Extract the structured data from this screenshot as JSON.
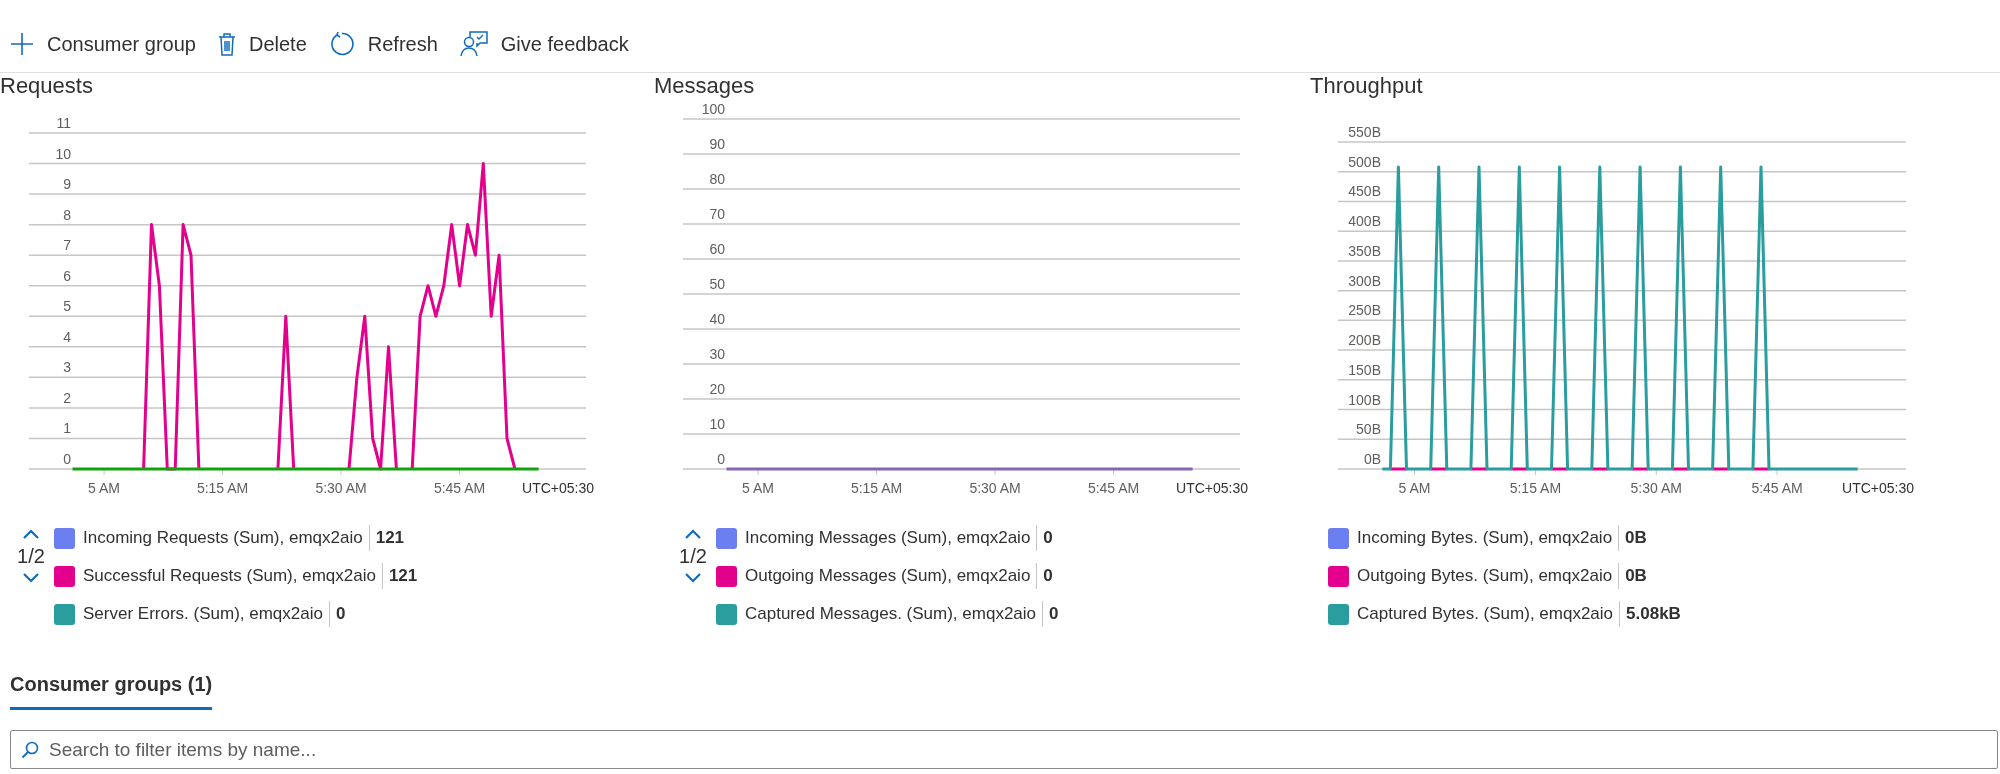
{
  "toolbar": [
    {
      "label": "Consumer group"
    },
    {
      "label": "Delete"
    },
    {
      "label": "Refresh"
    },
    {
      "label": "Give feedback"
    }
  ],
  "charts": [
    {
      "title": "Requests",
      "timezone": "UTC+05:30",
      "pager": "1/2",
      "chart_data": {
        "type": "line",
        "categories": [
          null,
          null,
          null,
          null,
          "5 AM",
          null,
          null,
          null,
          null,
          null,
          null,
          null,
          null,
          null,
          null,
          null,
          null,
          null,
          null,
          "5:15 AM",
          null,
          null,
          null,
          null,
          null,
          null,
          null,
          null,
          null,
          null,
          null,
          null,
          null,
          null,
          "5:30 AM",
          null,
          null,
          null,
          null,
          null,
          null,
          null,
          null,
          null,
          null,
          null,
          null,
          null,
          null,
          "5:45 AM",
          null,
          null,
          null,
          null,
          null,
          null,
          null,
          null,
          null,
          null
        ],
        "ylim": [
          0,
          11
        ],
        "yticks": [
          0,
          1,
          2,
          3,
          4,
          5,
          6,
          7,
          8,
          9,
          10,
          11
        ],
        "grid": true,
        "series": [
          {
            "name": "Incoming Requests (Sum), emqx2aio",
            "values": [
              null,
              null,
              null,
              null,
              null,
              null,
              null,
              null,
              null,
              null,
              null,
              null,
              null,
              null,
              null,
              null,
              null,
              null,
              null,
              null,
              null,
              null,
              null,
              null,
              null,
              null,
              null,
              null,
              null,
              null,
              null,
              null,
              null,
              null,
              null,
              null,
              null,
              null,
              null,
              null,
              null,
              null,
              null,
              null,
              null,
              null,
              null,
              null,
              null,
              null,
              null,
              null,
              null,
              null,
              null,
              null,
              null,
              null,
              null,
              null
            ]
          },
          {
            "name": "Successful Requests (Sum), emqx2aio",
            "color": "#e3008c",
            "values": [
              null,
              null,
              null,
              null,
              null,
              null,
              null,
              null,
              null,
              0,
              8,
              6,
              0,
              0,
              8,
              7,
              0,
              null,
              null,
              null,
              null,
              null,
              null,
              null,
              null,
              null,
              0,
              5,
              0,
              null,
              null,
              null,
              null,
              null,
              null,
              0,
              3,
              5,
              1,
              0,
              4,
              0,
              null,
              0,
              5,
              6,
              5,
              6,
              8,
              6,
              8,
              7,
              10,
              5,
              7,
              1,
              0,
              null,
              null,
              null
            ]
          },
          {
            "name": "Server Errors. (Sum), emqx2aio",
            "color": "#13a10e",
            "values": [
              0,
              0,
              0,
              0,
              0,
              0,
              0,
              0,
              0,
              0,
              0,
              0,
              0,
              0,
              0,
              0,
              0,
              0,
              0,
              0,
              0,
              0,
              0,
              0,
              0,
              0,
              0,
              0,
              0,
              0,
              0,
              0,
              0,
              0,
              0,
              0,
              0,
              0,
              0,
              0,
              0,
              0,
              0,
              0,
              0,
              0,
              0,
              0,
              0,
              0,
              0,
              0,
              0,
              0,
              0,
              0,
              0,
              0,
              0,
              0
            ]
          }
        ]
      },
      "legend": [
        {
          "color": "#6b7ff0",
          "value": "121"
        },
        {
          "color": "#e3008c",
          "value": "121"
        },
        {
          "color": "#2a9d9f",
          "value": "0"
        }
      ]
    },
    {
      "title": "Messages",
      "timezone": "UTC+05:30",
      "pager": "1/2",
      "chart_data": {
        "type": "line",
        "categories": [
          null,
          null,
          null,
          null,
          "5 AM",
          null,
          null,
          null,
          null,
          null,
          null,
          null,
          null,
          null,
          null,
          null,
          null,
          null,
          null,
          "5:15 AM",
          null,
          null,
          null,
          null,
          null,
          null,
          null,
          null,
          null,
          null,
          null,
          null,
          null,
          null,
          "5:30 AM",
          null,
          null,
          null,
          null,
          null,
          null,
          null,
          null,
          null,
          null,
          null,
          null,
          null,
          null,
          "5:45 AM",
          null,
          null,
          null,
          null,
          null,
          null,
          null,
          null,
          null,
          null
        ],
        "ylim": [
          0,
          100
        ],
        "yticks": [
          0,
          10,
          20,
          30,
          40,
          50,
          60,
          70,
          80,
          90,
          100
        ],
        "grid": true,
        "series": [
          {
            "name": "Incoming Messages (Sum), emqx2aio",
            "values": [
              null,
              null,
              null,
              null,
              null,
              null,
              null,
              null,
              null,
              null,
              null,
              null,
              null,
              null,
              null,
              null,
              null,
              null,
              null,
              null,
              null,
              null,
              null,
              null,
              null,
              null,
              null,
              null,
              null,
              null,
              null,
              null,
              null,
              null,
              null,
              null,
              null,
              null,
              null,
              null,
              null,
              null,
              null,
              null,
              null,
              null,
              null,
              null,
              null,
              null,
              null,
              null,
              null,
              null,
              null,
              null,
              null,
              null,
              null,
              null
            ]
          },
          {
            "name": "Outgoing Messages (Sum), emqx2aio",
            "values": [
              null,
              null,
              null,
              null,
              null,
              null,
              null,
              null,
              null,
              null,
              null,
              null,
              null,
              null,
              null,
              null,
              null,
              null,
              null,
              null,
              null,
              null,
              null,
              null,
              null,
              null,
              null,
              null,
              null,
              null,
              null,
              null,
              null,
              null,
              null,
              null,
              null,
              null,
              null,
              null,
              null,
              null,
              null,
              null,
              null,
              null,
              null,
              null,
              null,
              null,
              null,
              null,
              null,
              null,
              null,
              null,
              null,
              null,
              null,
              null
            ]
          },
          {
            "name": "Captured Messages. (Sum), emqx2aio",
            "color": "#8764b8",
            "values": [
              0,
              0,
              0,
              0,
              0,
              0,
              0,
              0,
              0,
              0,
              0,
              0,
              0,
              0,
              0,
              0,
              0,
              0,
              0,
              0,
              0,
              0,
              0,
              0,
              0,
              0,
              0,
              0,
              0,
              0,
              0,
              0,
              0,
              0,
              0,
              0,
              0,
              0,
              0,
              0,
              0,
              0,
              0,
              0,
              0,
              0,
              0,
              0,
              0,
              0,
              0,
              0,
              0,
              0,
              0,
              0,
              0,
              0,
              0,
              0
            ]
          }
        ]
      },
      "legend": [
        {
          "color": "#6b7ff0",
          "value": "0"
        },
        {
          "color": "#e3008c",
          "value": "0"
        },
        {
          "color": "#2a9d9f",
          "value": "0"
        }
      ]
    },
    {
      "title": "Throughput",
      "timezone": "UTC+05:30",
      "chart_data": {
        "type": "line",
        "categories": [
          null,
          null,
          null,
          null,
          "5 AM",
          null,
          null,
          null,
          null,
          null,
          null,
          null,
          null,
          null,
          null,
          null,
          null,
          null,
          null,
          "5:15 AM",
          null,
          null,
          null,
          null,
          null,
          null,
          null,
          null,
          null,
          null,
          null,
          null,
          null,
          null,
          "5:30 AM",
          null,
          null,
          null,
          null,
          null,
          null,
          null,
          null,
          null,
          null,
          null,
          null,
          null,
          null,
          "5:45 AM",
          null,
          null,
          null,
          null,
          null,
          null,
          null,
          null,
          null,
          null
        ],
        "ylim": [
          0,
          550
        ],
        "yticks": [
          {
            "value": 0,
            "label": "0B"
          },
          {
            "value": 50,
            "label": "50B"
          },
          {
            "value": 100,
            "label": "100B"
          },
          {
            "value": 150,
            "label": "150B"
          },
          {
            "value": 200,
            "label": "200B"
          },
          {
            "value": 250,
            "label": "250B"
          },
          {
            "value": 300,
            "label": "300B"
          },
          {
            "value": 350,
            "label": "350B"
          },
          {
            "value": 400,
            "label": "400B"
          },
          {
            "value": 450,
            "label": "450B"
          },
          {
            "value": 500,
            "label": "500B"
          },
          {
            "value": 550,
            "label": "550B"
          }
        ],
        "grid": true,
        "series": [
          {
            "name": "Incoming Bytes. (Sum), emqx2aio",
            "values": [
              null,
              null,
              null,
              null,
              null,
              null,
              null,
              null,
              null,
              null,
              null,
              null,
              null,
              null,
              null,
              null,
              null,
              null,
              null,
              null,
              null,
              null,
              null,
              null,
              null,
              null,
              null,
              null,
              null,
              null,
              null,
              null,
              null,
              null,
              null,
              null,
              null,
              null,
              null,
              null,
              null,
              null,
              null,
              null,
              null,
              null,
              null,
              null,
              null,
              null,
              null,
              null,
              null,
              null,
              null,
              null,
              null,
              null,
              null,
              null
            ]
          },
          {
            "name": "Outgoing Bytes. (Sum), emqx2aio",
            "color": "#e3008c",
            "values": [
              null,
              0,
              0,
              0,
              null,
              null,
              0,
              0,
              0,
              null,
              null,
              0,
              0,
              0,
              null,
              null,
              0,
              0,
              0,
              null,
              null,
              0,
              0,
              0,
              null,
              null,
              0,
              0,
              0,
              null,
              null,
              0,
              0,
              0,
              null,
              null,
              0,
              0,
              0,
              null,
              null,
              0,
              0,
              0,
              null,
              null,
              0,
              0,
              0,
              null,
              null,
              null,
              null,
              null,
              null,
              null,
              null,
              null,
              null,
              null
            ]
          },
          {
            "name": "Captured Bytes. (Sum), emqx2aio",
            "color": "#2a9d9f",
            "values": [
              0,
              0,
              508,
              0,
              0,
              0,
              0,
              508,
              0,
              0,
              0,
              0,
              508,
              0,
              0,
              0,
              0,
              508,
              0,
              0,
              0,
              0,
              508,
              0,
              0,
              0,
              0,
              508,
              0,
              0,
              0,
              0,
              508,
              0,
              0,
              0,
              0,
              508,
              0,
              0,
              0,
              0,
              508,
              0,
              0,
              0,
              0,
              508,
              0,
              0,
              0,
              0,
              0,
              0,
              0,
              0,
              0,
              0,
              0,
              0
            ]
          }
        ]
      },
      "legend": [
        {
          "color": "#6b7ff0",
          "value": "0B"
        },
        {
          "color": "#e3008c",
          "value": "0B"
        },
        {
          "color": "#2a9d9f",
          "value": "5.08kB"
        }
      ]
    }
  ],
  "tabs": [
    {
      "label": "Consumer groups (1)",
      "selected": true
    }
  ],
  "search": {
    "placeholder": "Search to filter items by name..."
  }
}
